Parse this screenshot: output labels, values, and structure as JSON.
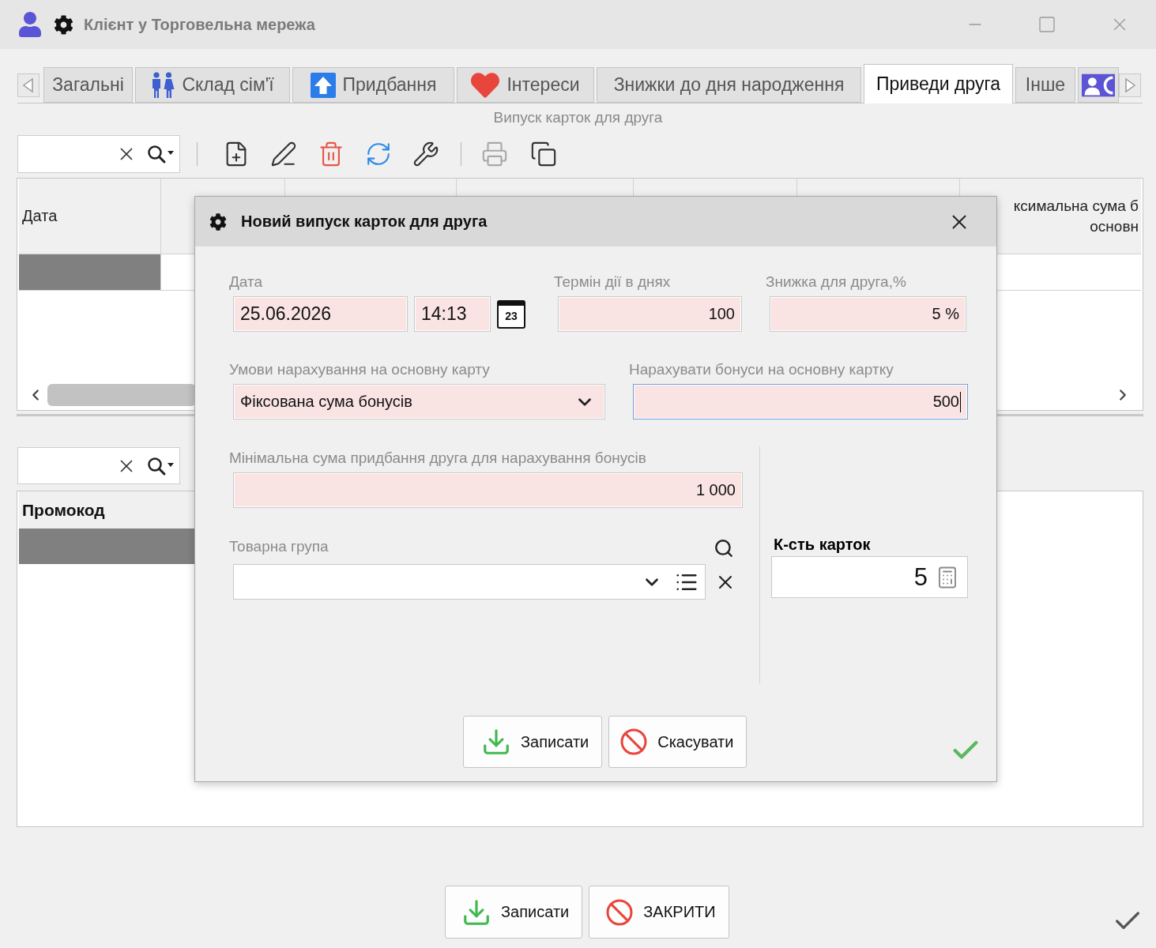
{
  "window": {
    "title": "Клієнт у Торговельна мережа"
  },
  "tabs": [
    {
      "label": "Загальні",
      "selected": false
    },
    {
      "label": "Склад сім'ї",
      "selected": false
    },
    {
      "label": "Придбання",
      "selected": false
    },
    {
      "label": "Інтереси",
      "selected": false
    },
    {
      "label": "Знижки до дня народження",
      "selected": false
    },
    {
      "label": "Приведи друга",
      "selected": true
    },
    {
      "label": "Інше",
      "selected": false
    },
    {
      "selected": false
    }
  ],
  "section_title": "Випуск карток для друга",
  "toolbar": {
    "buttons": [
      {
        "disabled": false
      },
      {
        "disabled": false
      },
      {
        "disabled": false
      },
      {
        "disabled": false
      },
      {
        "disabled": false
      },
      {
        "disabled": true
      },
      {
        "disabled": false
      }
    ]
  },
  "upper_table": {
    "column_1": "Дата",
    "column_7": [
      "ксимальна сума б",
      "основн"
    ],
    "rows": [
      {
        "selected": true
      }
    ]
  },
  "lower_table": {
    "column_1": "Промокод",
    "rows": [
      {
        "selected": true
      }
    ]
  },
  "dialog": {
    "title": "Новий випуск карток для друга",
    "date": {
      "label": "Дата",
      "value": "25.06.2026",
      "required": true,
      "focused": false
    },
    "time": {
      "value": "14:13",
      "required": true,
      "focused": false
    },
    "calendar_day": "23",
    "validity_days": {
      "label": "Термін дії в днях",
      "value": "100",
      "required": true,
      "focused": false
    },
    "friend_discount": {
      "label": "Знижка для друга,%",
      "value": "5 %",
      "required": true,
      "focused": false
    },
    "accrual_terms": {
      "label": "Умови нарахування на основну карту",
      "value": "Фіксована сума бонусів",
      "required": true
    },
    "bonus_amount": {
      "label": "Нарахувати бонуси на основну картку",
      "value": "500",
      "required": true,
      "focused": true
    },
    "min_purchase": {
      "label": "Мінімальна сума придбання друга для нарахування бонусів",
      "value": "1 000",
      "required": true,
      "focused": false
    },
    "product_group": {
      "label": "Товарна група",
      "required": false
    },
    "card_count": {
      "label": "К-сть карток",
      "value": "5",
      "required": false,
      "focused": false
    },
    "buttons": [
      {
        "label": "Записати",
        "kind": "save"
      },
      {
        "label": "Скасувати",
        "kind": "cancel"
      }
    ]
  },
  "buttons": [
    {
      "label": "Записати",
      "kind": "save"
    },
    {
      "label": "ЗАКРИТИ",
      "kind": "close"
    }
  ]
}
